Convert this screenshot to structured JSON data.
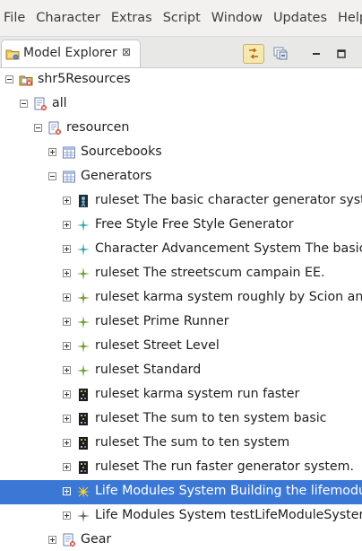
{
  "menu": [
    "File",
    "Character",
    "Extras",
    "Script",
    "Window",
    "Updates",
    "Help"
  ],
  "view": {
    "title": "Model Explorer",
    "close_glyph": "⊠",
    "toolbar": {
      "link_icon": "link-with-editor-icon",
      "collapse_icon": "collapse-all-icon",
      "minimize_icon": "minimize-icon",
      "maximize_icon": "maximize-icon"
    }
  },
  "colors": {
    "selection": "#3b78d6",
    "menubar": "#f2f1f0",
    "toolbar_pressed": "#f7e8b0"
  },
  "tree": [
    {
      "label": "shr5Resources",
      "depth": 0,
      "state": "expanded",
      "icon": "project-icon"
    },
    {
      "label": "all",
      "depth": 1,
      "state": "expanded",
      "icon": "resource-file-icon"
    },
    {
      "label": "resourcen",
      "depth": 2,
      "state": "expanded",
      "icon": "resource-file-icon"
    },
    {
      "label": "Sourcebooks",
      "depth": 3,
      "state": "collapsed",
      "icon": "table-icon"
    },
    {
      "label": "Generators",
      "depth": 3,
      "state": "expanded",
      "icon": "table-icon"
    },
    {
      "label": "ruleset The basic character generator syster",
      "depth": 4,
      "state": "collapsed",
      "icon": "dark-figure-icon"
    },
    {
      "label": "Free Style Free Style Generator",
      "depth": 4,
      "state": "collapsed",
      "icon": "teal-star-icon"
    },
    {
      "label": "Character Advancement System The basic ac",
      "depth": 4,
      "state": "collapsed",
      "icon": "teal-star-icon"
    },
    {
      "label": "ruleset The streetscum campain EE.",
      "depth": 4,
      "state": "collapsed",
      "icon": "green-star-icon"
    },
    {
      "label": "ruleset karma system roughly by Scion and S",
      "depth": 4,
      "state": "collapsed",
      "icon": "green-star-icon"
    },
    {
      "label": "ruleset Prime Runner",
      "depth": 4,
      "state": "collapsed",
      "icon": "green-star-icon"
    },
    {
      "label": "ruleset Street Level",
      "depth": 4,
      "state": "collapsed",
      "icon": "green-star-icon"
    },
    {
      "label": "ruleset Standard",
      "depth": 4,
      "state": "collapsed",
      "icon": "green-star-icon"
    },
    {
      "label": "ruleset karma system run faster",
      "depth": 4,
      "state": "collapsed",
      "icon": "dark-dice-icon"
    },
    {
      "label": "ruleset The sum to ten system basic",
      "depth": 4,
      "state": "collapsed",
      "icon": "dark-dice-icon"
    },
    {
      "label": "ruleset The sum to ten system",
      "depth": 4,
      "state": "collapsed",
      "icon": "dark-dice-icon"
    },
    {
      "label": "ruleset The run faster generator system.",
      "depth": 4,
      "state": "collapsed",
      "icon": "dark-dice-icon"
    },
    {
      "label": "Life Modules System Building the lifemodule",
      "depth": 4,
      "state": "collapsed",
      "icon": "yellow-star-icon",
      "selected": true
    },
    {
      "label": "Life Modules System testLifeModuleSystem",
      "depth": 4,
      "state": "collapsed",
      "icon": "gray-star-icon"
    },
    {
      "label": "Gear",
      "depth": 3,
      "state": "collapsed",
      "icon": "resource-file-icon"
    }
  ]
}
